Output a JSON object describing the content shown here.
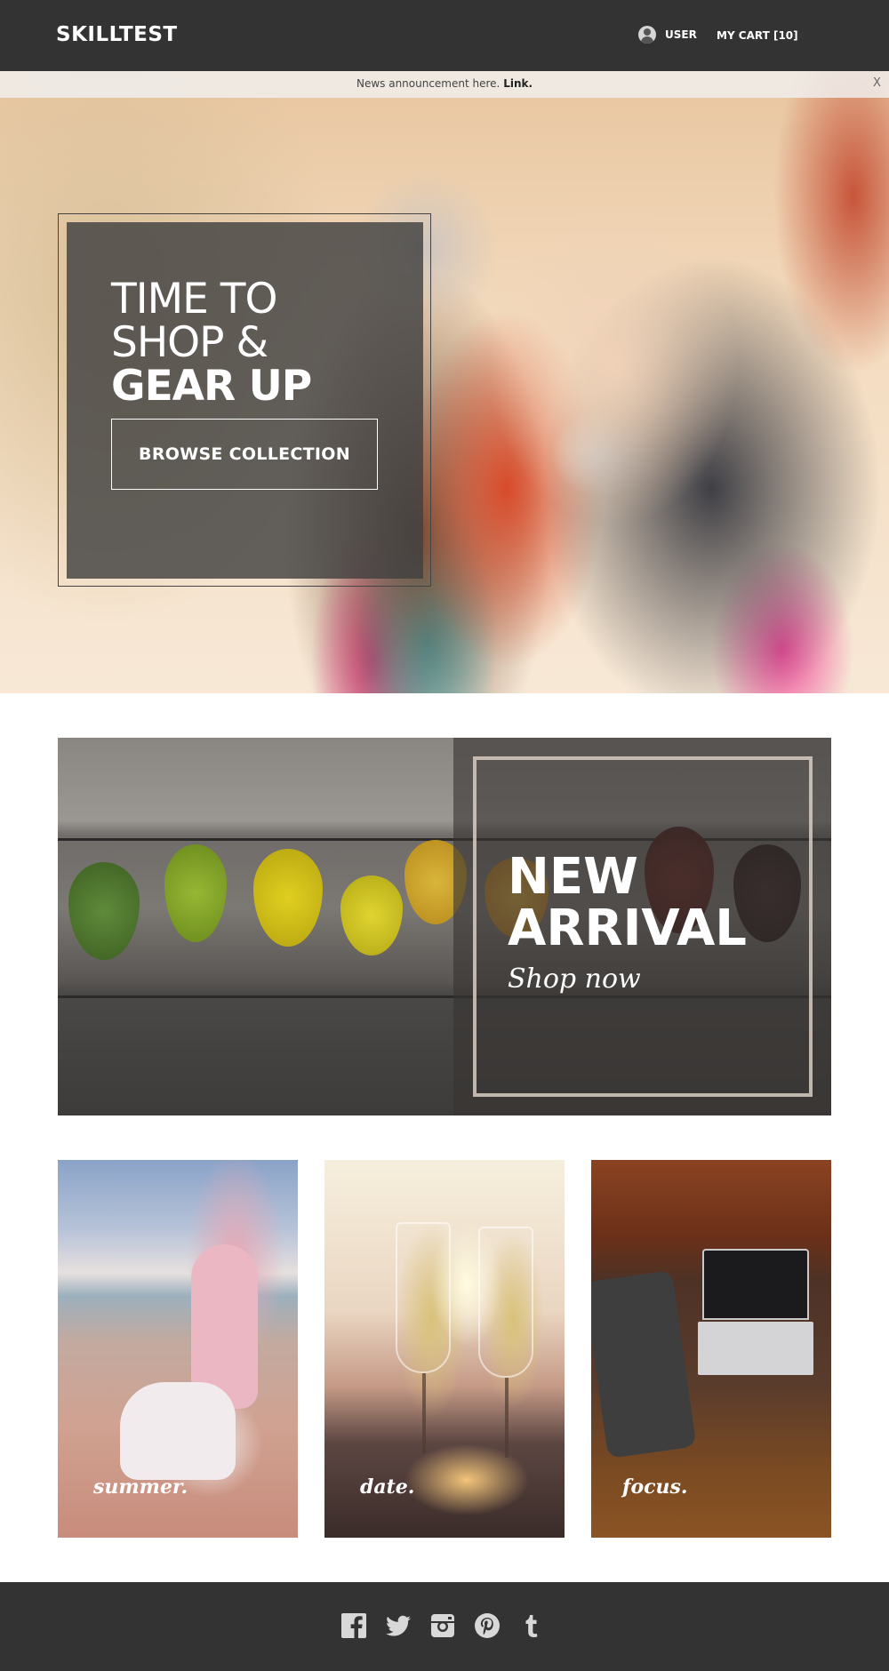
{
  "header": {
    "logo": "SKILLTEST",
    "user_label": "USER",
    "cart_label": "MY CART [10]"
  },
  "announcement": {
    "text": "News announcement here.",
    "link_label": "Link.",
    "close_label": "X"
  },
  "hero": {
    "title_line1": "TIME TO",
    "title_line2": "SHOP &",
    "title_line3": "GEAR UP",
    "button_label": "BROWSE COLLECTION"
  },
  "arrival": {
    "title_line1": "NEW",
    "title_line2": "ARRIVAL",
    "cta": "Shop now"
  },
  "tiles": [
    {
      "label": "summer."
    },
    {
      "label": "date."
    },
    {
      "label": "focus."
    }
  ],
  "footer": {
    "social": [
      "facebook-icon",
      "twitter-icon",
      "instagram-icon",
      "pinterest-icon",
      "tumblr-icon"
    ]
  },
  "colors": {
    "header_bg": "#333333",
    "footer_bg": "#333333",
    "panel_overlay": "#414141"
  }
}
